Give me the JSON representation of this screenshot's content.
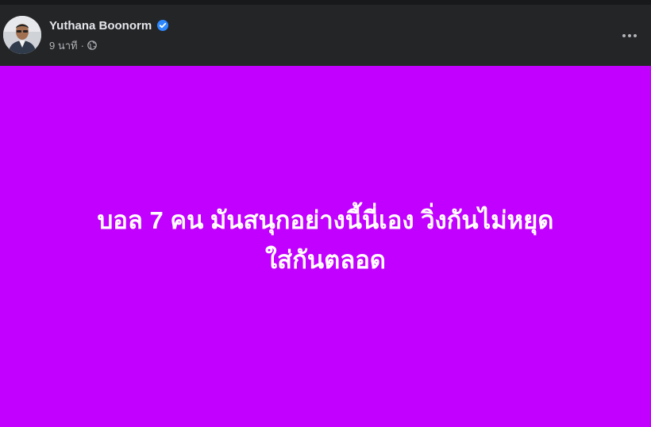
{
  "post": {
    "author_name": "Yuthana Boonorm",
    "verified_icon": "verified-badge-icon",
    "timestamp": "9 นาที",
    "separator": "·",
    "privacy_icon": "globe-icon",
    "more_icon": "more-options-icon",
    "status_lines": [
      "บอล 7 คน มันสนุกอย่างนี้นี่เอง วิ่งกันไม่หยุด",
      "ใส่กันตลอด"
    ],
    "colors": {
      "background": "#c100ff",
      "text": "#ffffff",
      "header_bg": "#242526",
      "verified": "#2d88ff"
    }
  }
}
